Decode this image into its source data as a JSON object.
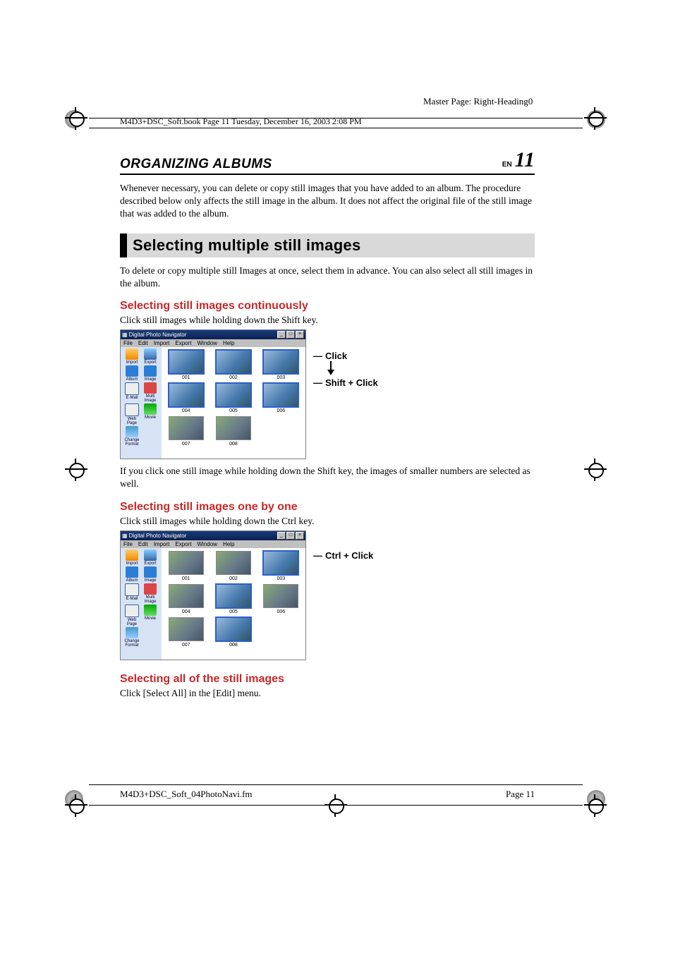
{
  "meta": {
    "master_page": "Master Page: Right-Heading0",
    "header": "M4D3+DSC_Soft.book  Page 11  Tuesday, December 16, 2003  2:08 PM",
    "footer_left": "M4D3+DSC_Soft_04PhotoNavi.fm",
    "footer_right": "Page  11"
  },
  "chapter": {
    "title": "ORGANIZING ALBUMS",
    "lang": "EN",
    "page": "11"
  },
  "intro": "Whenever necessary, you can delete or copy still images that you have added to an album. The procedure described below only affects the still image in the album. It does not affect the original file of the still image that was added to the album.",
  "banner": "Selecting multiple still images",
  "banner_sub": "To delete or copy multiple still Images at once, select them in advance. You can also select all still images in the album.",
  "sec1": {
    "heading": "Selecting still images continuously",
    "instr": "Click still images while holding down the Shift key.",
    "callout1": "Click",
    "callout2": "Shift + Click",
    "after": "If you click one still image while holding down the Shift key, the images of smaller numbers are selected as well."
  },
  "sec2": {
    "heading": "Selecting still images one by one",
    "instr": "Click still images while holding down the Ctrl key.",
    "callout": "Ctrl + Click"
  },
  "sec3": {
    "heading": "Selecting all of the still images",
    "instr": "Click [Select All] in the [Edit] menu."
  },
  "app": {
    "title": "Digital Photo Navigator",
    "menus": [
      "File",
      "Edit",
      "Import",
      "Export",
      "Window",
      "Help"
    ],
    "sidebar": [
      [
        "Import",
        "Export"
      ],
      [
        "Album",
        "Image"
      ],
      [
        "E-Mail",
        "Multi Image"
      ],
      [
        "Web Page",
        "Movie"
      ],
      [
        "Change Format",
        ""
      ]
    ],
    "thumbs": [
      "001",
      "002",
      "003",
      "004",
      "005",
      "006",
      "007",
      "008"
    ]
  }
}
